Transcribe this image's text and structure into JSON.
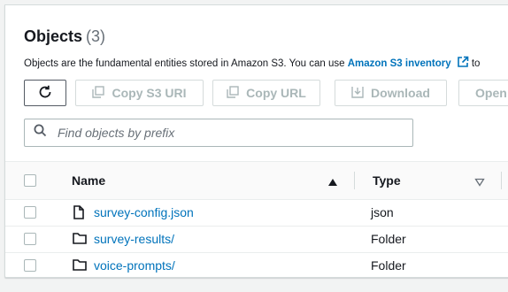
{
  "objects": {
    "title": "Objects",
    "count": "(3)",
    "description": "Objects are the fundamental entities stored in Amazon S3. You can use",
    "inventory_link": "Amazon S3 inventory",
    "description_tail": "to"
  },
  "toolbar": {
    "copy_s3_uri": "Copy S3 URI",
    "copy_url": "Copy URL",
    "download": "Download",
    "open": "Open"
  },
  "search": {
    "placeholder": "Find objects by prefix"
  },
  "table": {
    "columns": [
      "Name",
      "Type"
    ],
    "rows": [
      {
        "name": "survey-config.json",
        "type": "json",
        "icon": "file-icon"
      },
      {
        "name": "survey-results/",
        "type": "Folder",
        "icon": "folder-icon"
      },
      {
        "name": "voice-prompts/",
        "type": "Folder",
        "icon": "folder-icon"
      }
    ]
  },
  "colors": {
    "link": "#0073bb",
    "disabled": "#aab7b8",
    "text": "#16191f"
  }
}
